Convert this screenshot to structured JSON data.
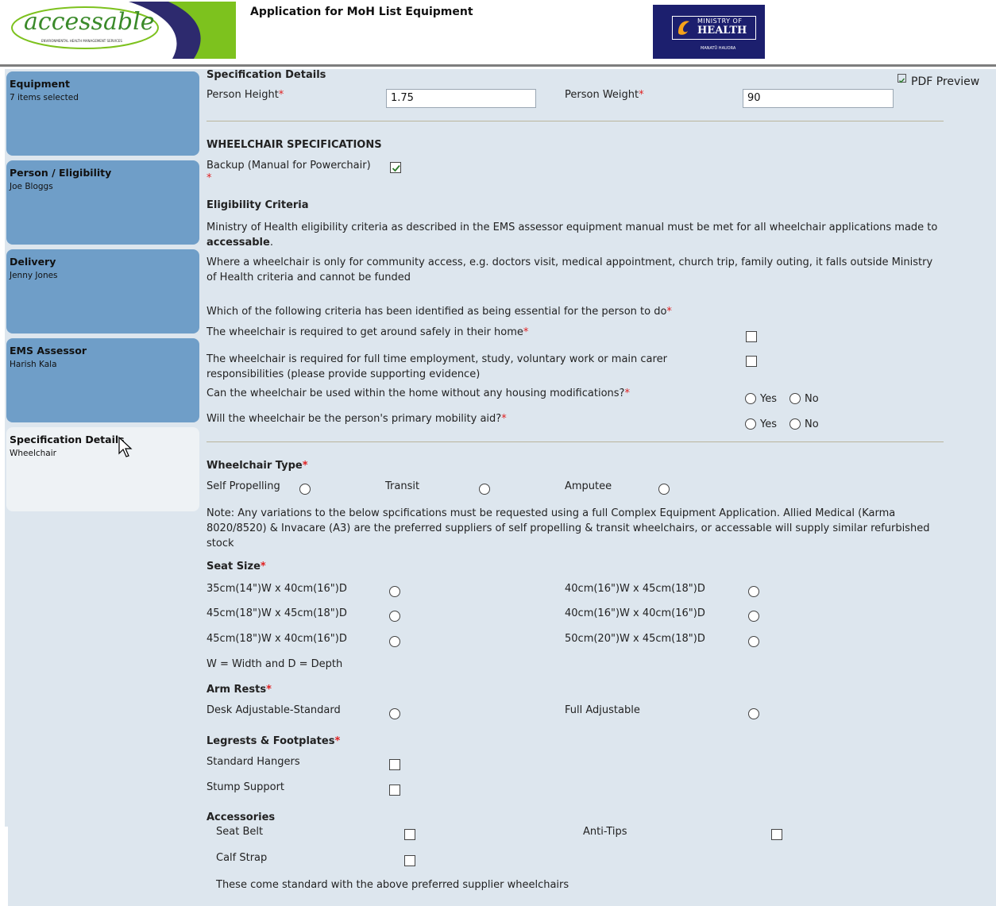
{
  "header": {
    "logo_text": "accessable",
    "logo_tagline": "ENVIRONMENTAL HEALTH MANAGEMENT SERVICES",
    "title": "Application for MoH List Equipment",
    "moh_line1": "MINISTRY OF",
    "moh_line2": "HEALTH",
    "moh_line3": "MANATŪ HAUORA"
  },
  "sidebar": {
    "items": [
      {
        "title": "Equipment",
        "sub": "7 items selected"
      },
      {
        "title": "Person / Eligibility",
        "sub": "Joe Bloggs"
      },
      {
        "title": "Delivery",
        "sub": "Jenny Jones"
      },
      {
        "title": "EMS Assessor",
        "sub": "Harish Kala"
      },
      {
        "title": "Specification Details",
        "sub": "Wheelchair"
      }
    ]
  },
  "form": {
    "section_title": "Specification Details",
    "pdf_preview": "PDF Preview",
    "person_height_label": "Person Height",
    "person_height_value": "1.75",
    "person_weight_label": "Person Weight",
    "person_weight_value": "90",
    "req": "*",
    "wheelchair_specs": "WHEELCHAIR SPECIFICATIONS",
    "backup_label": "Backup (Manual for Powerchair)",
    "eligibility_title": "Eligibility Criteria",
    "elig_text1a": "Ministry of Health eligibility criteria as described in the EMS assessor equipment manual must be met for all wheelchair applications made to ",
    "elig_text1b": "accessable",
    "elig_text1c": ".",
    "elig_text2": "Where a wheelchair is only for community access, e.g. doctors visit, medical appointment, church trip, family outing, it falls outside Ministry of Health criteria and cannot be funded",
    "which_criteria": "Which of the following criteria has been identified as being essential for the person to do",
    "crit1": "The wheelchair is required to get around safely in their home",
    "crit2": "The wheelchair is required for full time employment, study, voluntary work or main carer responsibilities (please provide supporting evidence)",
    "q_mods": "Can the wheelchair be used within the home without any housing modifications?",
    "q_primary": "Will the wheelchair be the person's primary mobility aid?",
    "yes": "Yes",
    "no": "No",
    "wheelchair_type": "Wheelchair Type",
    "type_self": "Self Propelling",
    "type_transit": "Transit",
    "type_amputee": "Amputee",
    "note": "Note: Any variations to the below spcifications must be requested using a full Complex Equipment Application. Allied Medical (Karma 8020/8520) & Invacare (A3) are the preferred suppliers of self propelling & transit wheelchairs, or accessable will supply similar refurbished stock",
    "seat_size": "Seat Size",
    "seat1": "35cm(14\")W x 40cm(16\")D",
    "seat2": "40cm(16\")W x 45cm(18\")D",
    "seat3": "45cm(18\")W x 45cm(18\")D",
    "seat4": "40cm(16\")W x 40cm(16\")D",
    "seat5": "45cm(18\")W x 40cm(16\")D",
    "seat6": "50cm(20\")W x 45cm(18\")D",
    "wd_note": "W = Width and D = Depth",
    "arm_rests": "Arm Rests",
    "arm_desk": "Desk Adjustable-Standard",
    "arm_full": "Full Adjustable",
    "legrests": "Legrests & Footplates",
    "leg_standard": "Standard Hangers",
    "leg_stump": "Stump Support",
    "accessories": "Accessories",
    "acc_seatbelt": "Seat Belt",
    "acc_antitips": "Anti-Tips",
    "acc_calf": "Calf Strap",
    "acc_note": "These come standard with the above preferred supplier wheelchairs"
  }
}
